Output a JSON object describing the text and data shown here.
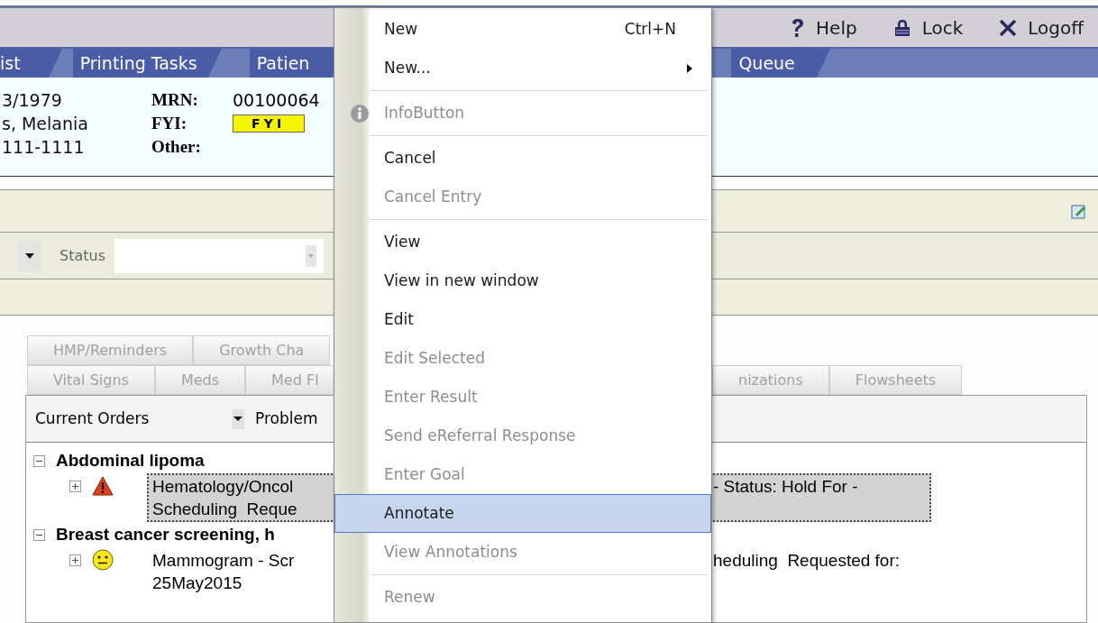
{
  "toolbar": {
    "buttons": [
      {
        "kind": "help",
        "label": "Help"
      },
      {
        "kind": "lock",
        "label": "Lock"
      },
      {
        "kind": "logoff",
        "label": "Logoff"
      }
    ]
  },
  "nav_tabs": {
    "left": [
      "ist",
      "Printing Tasks",
      "Patien"
    ],
    "right": [
      "Queue"
    ]
  },
  "patient_banner": {
    "details": [
      "3/1979",
      "s, Melania",
      "111-1111"
    ],
    "fields": [
      {
        "label": "MRN:",
        "value": "00100064"
      },
      {
        "label": "FYI:",
        "badge": "FYI"
      },
      {
        "label": "Other:"
      }
    ]
  },
  "filter": {
    "label": "Status"
  },
  "view_tabs": {
    "rows": [
      {
        "left": [
          "HMP/Reminders",
          "Growth Cha"
        ],
        "right": []
      },
      {
        "left": [
          "Vital Signs",
          "Meds",
          "Med Fl"
        ],
        "right": [
          "nizations",
          "Flowsheets"
        ]
      }
    ]
  },
  "orders_panel": {
    "view": "Current Orders",
    "problem_label": "Problem",
    "problems": [
      {
        "title": "Abdominal lipoma",
        "expanded": true,
        "children": [
          {
            "kind": "warning",
            "expanded": false,
            "selected": true,
            "text_left": [
              "Hematology/Oncol",
              "Scheduling  Reque"
            ],
            "text_right": [
              "- Status: Hold For -"
            ]
          }
        ]
      },
      {
        "title": "Breast cancer screening, h",
        "expanded": true,
        "children": [
          {
            "kind": "neutral-face",
            "expanded": false,
            "selected": false,
            "text_left": [
              "Mammogram - Scr",
              "25May2015"
            ],
            "text_right": [
              "heduling  Requested for:"
            ]
          }
        ]
      }
    ]
  },
  "context_menu": {
    "items": [
      {
        "kind": "item",
        "label": "New",
        "shortcut": "Ctrl+N",
        "submenu": false,
        "disabled": false,
        "selected": false
      },
      {
        "kind": "item",
        "label": "New...",
        "submenu": true,
        "disabled": false,
        "selected": false
      },
      {
        "kind": "separator"
      },
      {
        "kind": "info-item",
        "label": "InfoButton",
        "submenu": false,
        "disabled": true,
        "selected": false
      },
      {
        "kind": "separator"
      },
      {
        "kind": "item",
        "label": "Cancel",
        "submenu": false,
        "disabled": false,
        "selected": false
      },
      {
        "kind": "item",
        "label": "Cancel Entry",
        "submenu": false,
        "disabled": true,
        "selected": false
      },
      {
        "kind": "separator"
      },
      {
        "kind": "item",
        "label": "View",
        "submenu": false,
        "disabled": false,
        "selected": false
      },
      {
        "kind": "item",
        "label": "View in new window",
        "submenu": false,
        "disabled": false,
        "selected": false
      },
      {
        "kind": "item",
        "label": "Edit",
        "submenu": false,
        "disabled": false,
        "selected": false
      },
      {
        "kind": "item",
        "label": "Edit Selected",
        "submenu": false,
        "disabled": true,
        "selected": false
      },
      {
        "kind": "item",
        "label": "Enter Result",
        "submenu": false,
        "disabled": true,
        "selected": false
      },
      {
        "kind": "item",
        "label": "Send eReferral Response",
        "submenu": false,
        "disabled": true,
        "selected": false
      },
      {
        "kind": "item",
        "label": "Enter Goal",
        "submenu": false,
        "disabled": true,
        "selected": false
      },
      {
        "kind": "item",
        "label": "Annotate",
        "submenu": false,
        "disabled": false,
        "selected": true
      },
      {
        "kind": "item",
        "label": "View Annotations",
        "submenu": false,
        "disabled": true,
        "selected": false
      },
      {
        "kind": "separator"
      },
      {
        "kind": "item",
        "label": "Renew",
        "submenu": false,
        "disabled": true,
        "selected": false
      }
    ]
  }
}
